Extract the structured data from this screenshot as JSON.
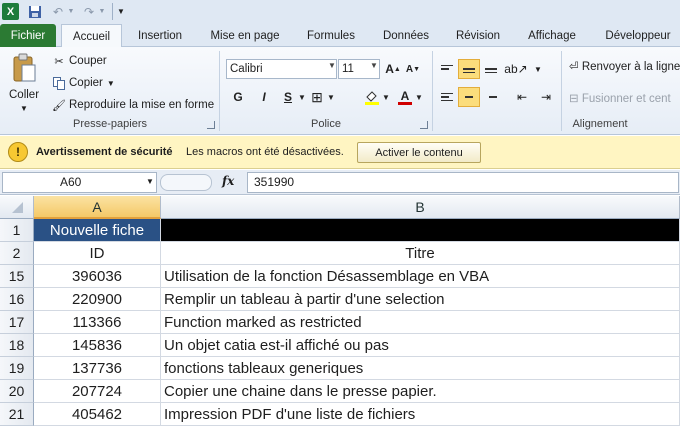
{
  "quick_access": {
    "app_logo": "X",
    "icons": [
      "excel-logo-icon",
      "save-icon",
      "undo-icon",
      "redo-icon",
      "customize-icon"
    ]
  },
  "tabs": [
    {
      "label": "Fichier"
    },
    {
      "label": "Accueil"
    },
    {
      "label": "Insertion"
    },
    {
      "label": "Mise en page"
    },
    {
      "label": "Formules"
    },
    {
      "label": "Données"
    },
    {
      "label": "Révision"
    },
    {
      "label": "Affichage"
    },
    {
      "label": "Développeur"
    }
  ],
  "ribbon": {
    "clipboard": {
      "paste_label": "Coller",
      "cut_label": "Couper",
      "copy_label": "Copier",
      "format_painter_label": "Reproduire la mise en forme",
      "group_label": "Presse-papiers"
    },
    "font": {
      "font_name": "Calibri",
      "font_size": "11",
      "bold": "G",
      "italic": "I",
      "underline": "S",
      "strike": "S",
      "grow": "A",
      "shrink": "A",
      "font_color_glyph": "A",
      "group_label": "Police"
    },
    "alignment": {
      "wrap_text_label": "Renvoyer à la ligne",
      "merge_label": "Fusionner et cent",
      "group_label": "Alignement"
    }
  },
  "security_bar": {
    "title": "Avertissement de sécurité",
    "message": "Les macros ont été désactivées.",
    "button_label": "Activer le contenu"
  },
  "formula_bar": {
    "name_box": "A60",
    "fx_label": "fx",
    "formula": "351990"
  },
  "sheet": {
    "columns": [
      "A",
      "B"
    ],
    "header_row": {
      "row": "1",
      "a": "Nouvelle fiche",
      "b": ""
    },
    "label_row": {
      "row": "2",
      "a": "ID",
      "b": "Titre"
    },
    "rows": [
      {
        "row": "15",
        "id": "396036",
        "title": "Utilisation de la fonction Désassemblage en VBA"
      },
      {
        "row": "16",
        "id": "220900",
        "title": "Remplir un tableau à partir d'une selection"
      },
      {
        "row": "17",
        "id": "113366",
        "title": "Function marked as restricted"
      },
      {
        "row": "18",
        "id": "145836",
        "title": "Un objet catia est-il affiché ou pas"
      },
      {
        "row": "19",
        "id": "137736",
        "title": "fonctions tableaux generiques"
      },
      {
        "row": "20",
        "id": "207724",
        "title": "Copier une chaine dans le presse papier."
      },
      {
        "row": "21",
        "id": "405462",
        "title": "Impression PDF d'une liste de fichiers"
      }
    ]
  },
  "colors": {
    "header_fill": "#2a5185",
    "black_fill": "#000000",
    "selected_col": "#f4c968",
    "file_tab": "#2b7a33",
    "security_bar": "#fff5c2"
  }
}
